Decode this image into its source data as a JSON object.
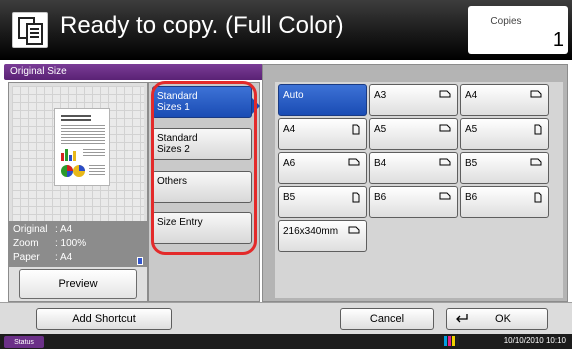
{
  "header": {
    "title": "Ready to copy. (Full Color)",
    "copies_label": "Copies",
    "copies_value": "1",
    "icon": "copy-icon"
  },
  "title_bar": {
    "label": "Original Size"
  },
  "preview": {
    "info": [
      {
        "key": "Original",
        "value": ": A4"
      },
      {
        "key": "Zoom",
        "value": ": 100%"
      },
      {
        "key": "Paper",
        "value": ": A4"
      }
    ],
    "preview_button": "Preview"
  },
  "categories": {
    "selected": 0,
    "items": [
      {
        "label_line1": "Standard",
        "label_line2": "Sizes 1"
      },
      {
        "label_line1": "Standard",
        "label_line2": "Sizes 2"
      },
      {
        "label_line1": "Others",
        "label_line2": ""
      },
      {
        "label_line1": "Size Entry",
        "label_line2": ""
      }
    ]
  },
  "sizes": {
    "selected": "Auto",
    "rows": [
      [
        {
          "label": "Auto",
          "orient": "none"
        },
        {
          "label": "A3",
          "orient": "landscape"
        },
        {
          "label": "A4",
          "orient": "landscape"
        }
      ],
      [
        {
          "label": "A4",
          "orient": "portrait"
        },
        {
          "label": "A5",
          "orient": "landscape"
        },
        {
          "label": "A5",
          "orient": "portrait"
        }
      ],
      [
        {
          "label": "A6",
          "orient": "landscape"
        },
        {
          "label": "B4",
          "orient": "landscape"
        },
        {
          "label": "B5",
          "orient": "landscape"
        }
      ],
      [
        {
          "label": "B5",
          "orient": "portrait"
        },
        {
          "label": "B6",
          "orient": "landscape"
        },
        {
          "label": "B6",
          "orient": "portrait"
        }
      ],
      [
        {
          "label": "216x340mm",
          "orient": "landscape"
        }
      ]
    ]
  },
  "bottom": {
    "add_shortcut": "Add Shortcut",
    "cancel": "Cancel",
    "ok": "OK"
  },
  "status": {
    "label": "Status",
    "datetime": "10/10/2010 10:10"
  },
  "colors": {
    "accent_purple": "#5a2275",
    "selected_blue": "#1a4cb4",
    "highlight_red": "#e32a2a"
  }
}
